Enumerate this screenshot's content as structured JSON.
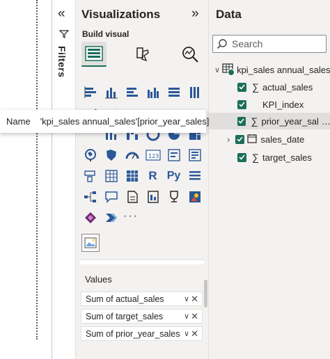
{
  "filters": {
    "label": "Filters",
    "collapse_icon": "double-chevron-left",
    "filter_icon": "funnel"
  },
  "visualizations": {
    "title": "Visualizations",
    "expand_icon": "double-chevron-right",
    "build_visual_label": "Build visual",
    "tabs": [
      {
        "name": "build-visual-tab",
        "icon": "build-visual-icon",
        "active": true
      },
      {
        "name": "format-visual-tab",
        "icon": "format-paintbrush-icon",
        "active": false
      },
      {
        "name": "analytics-tab",
        "icon": "analytics-magnifier-icon",
        "active": false
      }
    ],
    "more_label": "···",
    "values_label": "Values",
    "value_wells": [
      {
        "label": "Sum of actual_sales"
      },
      {
        "label": "Sum of target_sales"
      },
      {
        "label": "Sum of prior_year_sales"
      }
    ]
  },
  "data": {
    "title": "Data",
    "search_placeholder": "Search",
    "table": {
      "name": "kpi_sales annual_sales",
      "expanded": true
    },
    "fields": [
      {
        "name": "actual_sales",
        "sigma": "∑",
        "checked": true,
        "type": "measure"
      },
      {
        "name": "KPI_index",
        "sigma": "",
        "checked": true,
        "type": "column"
      },
      {
        "name": "prior_year_sal...",
        "sigma": "∑",
        "checked": true,
        "type": "measure",
        "hovered": true
      },
      {
        "name": "sales_date",
        "sigma": "",
        "checked": false,
        "type": "date-hierarchy",
        "expandable": true
      },
      {
        "name": "target_sales",
        "sigma": "∑",
        "checked": true,
        "type": "measure"
      }
    ],
    "row_more": "…"
  },
  "tooltip": {
    "name_label": "Name",
    "value": "'kpi_sales annual_sales'[prior_year_sales]"
  },
  "colors": {
    "accent": "#1b6e5a",
    "pane": "#f3f2f1",
    "viz_blue": "#2b5797"
  }
}
